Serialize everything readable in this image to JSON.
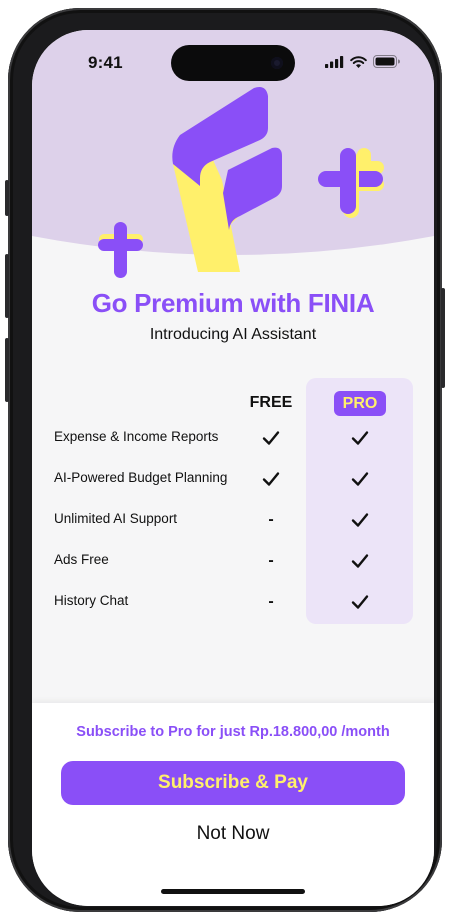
{
  "status_bar": {
    "time": "9:41",
    "icons": [
      "signal-icon",
      "wifi-icon",
      "battery-icon"
    ]
  },
  "brand": {
    "logo": "finia-f-logo",
    "accent": "#8a4ff7",
    "highlight": "#fff06b",
    "header_bg": "#ddd1ea"
  },
  "hero": {
    "title": "Go Premium with FINIA",
    "subtitle": "Introducing AI Assistant"
  },
  "comparison": {
    "columns": {
      "free": "FREE",
      "pro": "PRO"
    },
    "rows": [
      {
        "feature": "Expense & Income Reports",
        "free": "check",
        "pro": "check"
      },
      {
        "feature": "AI-Powered Budget Planning",
        "free": "check",
        "pro": "check"
      },
      {
        "feature": "Unlimited AI Support",
        "free": "-",
        "pro": "check"
      },
      {
        "feature": "Ads Free",
        "free": "-",
        "pro": "check"
      },
      {
        "feature": "History Chat",
        "free": "-",
        "pro": "check"
      }
    ]
  },
  "footer": {
    "price_text": "Subscribe to Pro for just Rp.18.800,00 /month",
    "subscribe_label": "Subscribe & Pay",
    "dismiss_label": "Not Now"
  }
}
